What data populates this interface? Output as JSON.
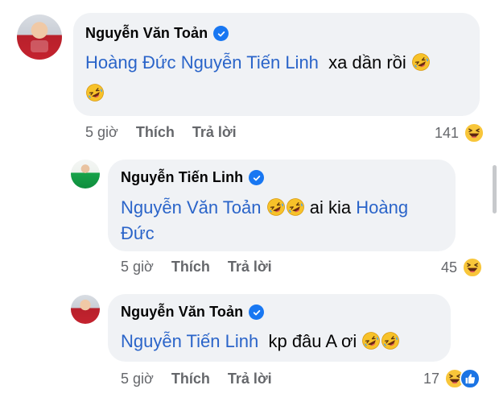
{
  "comments": [
    {
      "author": "Nguyễn Văn Toản",
      "mention1": "Hoàng Đức",
      "mention2": "Nguyễn Tiến Linh",
      "text": "xa dần rồi",
      "time": "5 giờ",
      "like_label": "Thích",
      "reply_label": "Trả lời",
      "reaction_count": "141"
    },
    {
      "author": "Nguyễn Tiến Linh",
      "mention1": "Nguyễn Văn Toản",
      "text": "ai kia",
      "mention2_part1": "Hoàng",
      "mention2_part2": "Đức",
      "time": "5 giờ",
      "like_label": "Thích",
      "reply_label": "Trả lời",
      "reaction_count": "45"
    },
    {
      "author": "Nguyễn Văn Toản",
      "mention1": "Nguyễn Tiến Linh",
      "text": "kp đâu A ơi",
      "time": "5 giờ",
      "like_label": "Thích",
      "reply_label": "Trả lời",
      "reaction_count": "17"
    }
  ],
  "icons": {
    "verified": "verified-badge-icon",
    "laugh_emoji": "rolling-on-floor-laughing-emoji",
    "haha_reaction": "haha-reaction-icon",
    "like_reaction": "like-reaction-icon"
  },
  "colors": {
    "bubble": "#f0f2f5",
    "mention": "#2a64c9",
    "meta": "#65676b",
    "verified": "#1877f2"
  }
}
